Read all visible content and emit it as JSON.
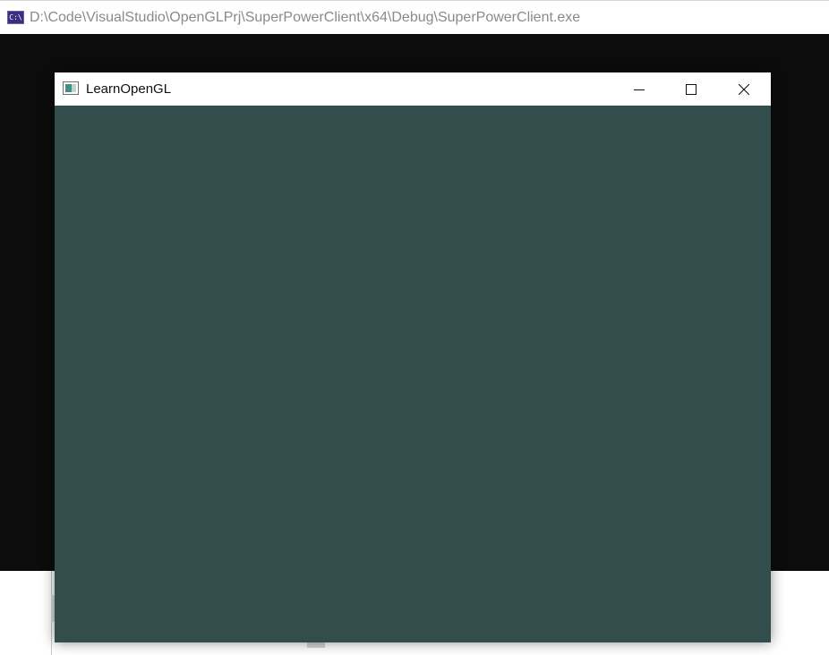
{
  "console": {
    "icon": "cmd-icon",
    "icon_label": "C:\\",
    "title": "D:\\Code\\VisualStudio\\OpenGLPrj\\SuperPowerClient\\x64\\Debug\\SuperPowerClient.exe"
  },
  "gl_window": {
    "icon": "application-window-icon",
    "title": "LearnOpenGL",
    "controls": {
      "minimize_icon": "minimize-icon",
      "maximize_icon": "maximize-icon",
      "close_icon": "close-icon"
    },
    "clear_color": "#334d4d"
  },
  "colors": {
    "console_background": "#0c0c0c",
    "console_title_text": "#8a8a8a",
    "titlebar": "#ffffff"
  }
}
